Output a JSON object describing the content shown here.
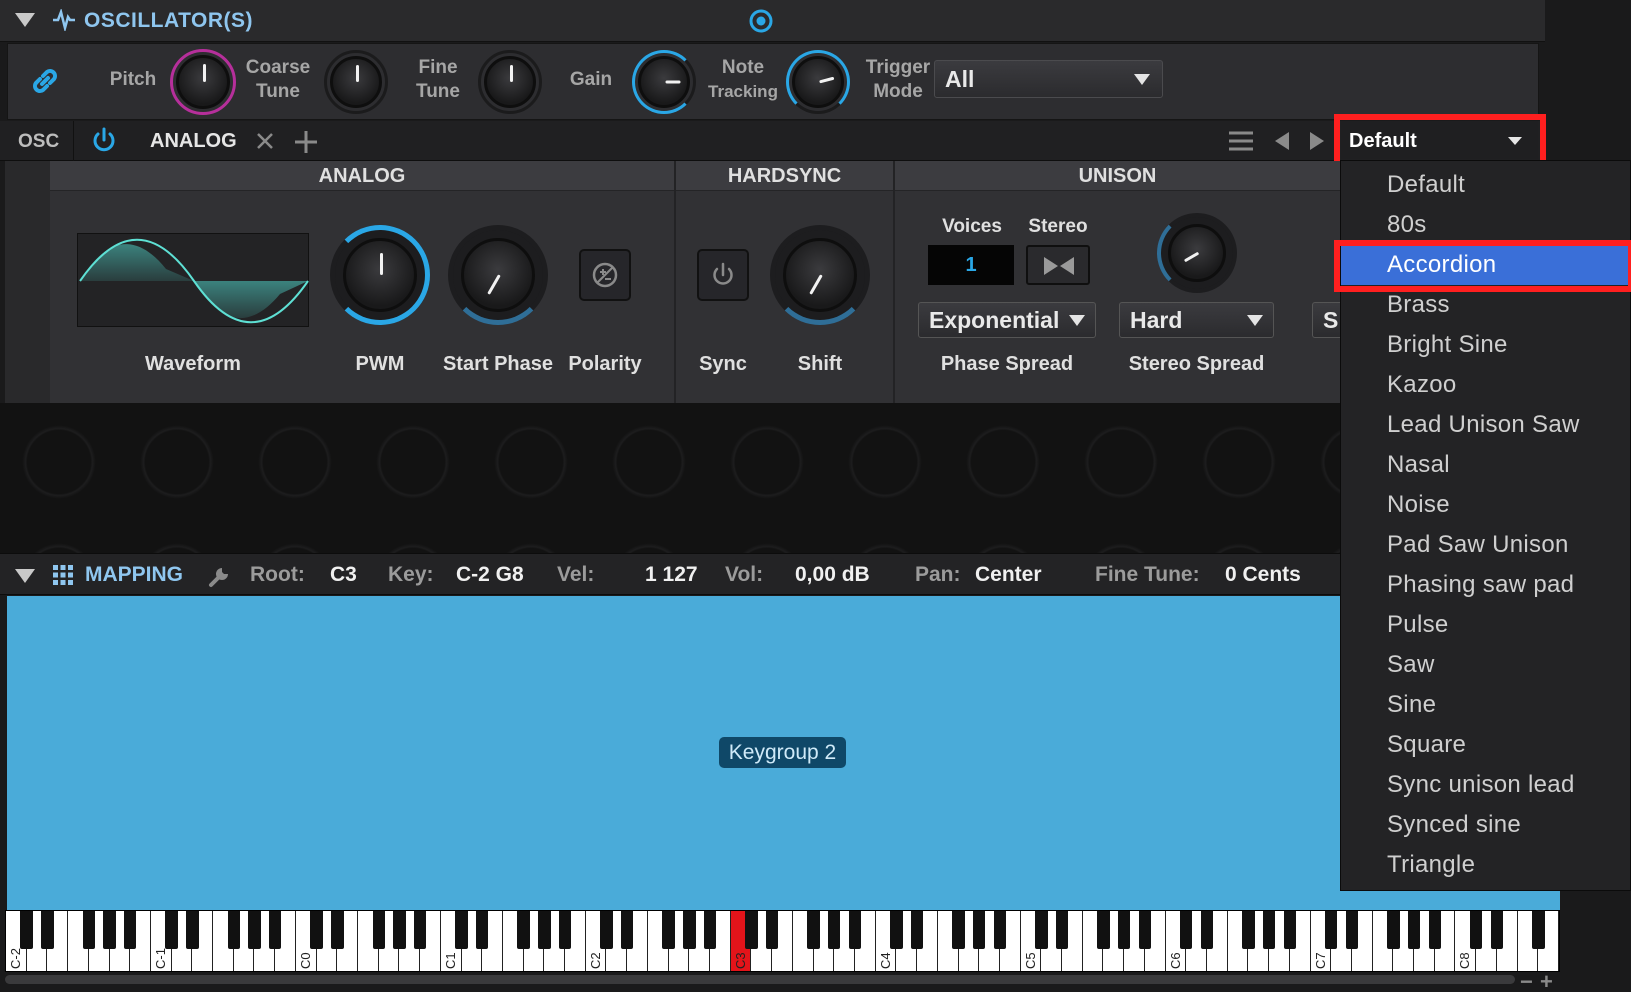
{
  "oscillators": {
    "title": "OSCILLATOR(S)",
    "knobs": [
      {
        "label1": "Pitch",
        "label2": ""
      },
      {
        "label1": "Coarse",
        "label2": "Tune"
      },
      {
        "label1": "Fine",
        "label2": "Tune"
      },
      {
        "label1": "Gain",
        "label2": ""
      },
      {
        "label1": "Note",
        "label2": "Tracking"
      },
      {
        "label1": "Trigger",
        "label2": "Mode"
      }
    ],
    "trigger_mode_value": "All"
  },
  "osc_tabs": {
    "osc_label": "OSC",
    "tab_label": "ANALOG",
    "preset_value": "Default"
  },
  "sections": {
    "analog": {
      "title": "ANALOG",
      "labels": [
        "Waveform",
        "PWM",
        "Start Phase",
        "Polarity"
      ]
    },
    "hardsync": {
      "title": "HARDSYNC",
      "labels": [
        "Sync",
        "Shift"
      ]
    },
    "unison": {
      "title": "UNISON",
      "voices_label": "Voices",
      "stereo_label": "Stereo",
      "voices_value": "1",
      "phase_spread_value": "Exponential",
      "phase_spread_label": "Phase Spread",
      "stereo_spread_value": "Hard",
      "stereo_spread_label": "Stereo Spread",
      "cut_value": "S"
    }
  },
  "mapping": {
    "title": "MAPPING",
    "root_label": "Root:",
    "root_value": "C3",
    "key_label": "Key:",
    "key_value": "C-2 G8",
    "vel_label": "Vel:",
    "vel_value": "1 127",
    "vol_label": "Vol:",
    "vol_value": "0,00 dB",
    "pan_label": "Pan:",
    "pan_value": "Center",
    "finetune_label": "Fine Tune:",
    "finetune_value": "0 Cents",
    "keygroup_label": "Keygroup 2"
  },
  "keyboard": {
    "octave_labels": [
      "C-2",
      "C-1",
      "C0",
      "C1",
      "C2",
      "C3",
      "C4",
      "C5",
      "C6",
      "C7",
      "C8"
    ],
    "highlight_key": "C3",
    "zoom_minus": "−",
    "zoom_plus": "+"
  },
  "preset_menu": {
    "items": [
      "Default",
      "80s",
      "Accordion",
      "Brass",
      "Bright Sine",
      "Kazoo",
      "Lead Unison Saw",
      "Nasal",
      "Noise",
      "Pad Saw Unison",
      "Phasing saw pad",
      "Pulse",
      "Saw",
      "Sine",
      "Square",
      "Sync unison lead",
      "Synced sine",
      "Triangle"
    ],
    "selected": "Accordion"
  },
  "colors": {
    "accent_blue": "#2aa7e6",
    "pitch_ring": "#b62f9b",
    "menu_highlight": "#3a6fd8",
    "annotation_red": "#ff1f1f",
    "mapping_zone": "#4aabd9"
  }
}
